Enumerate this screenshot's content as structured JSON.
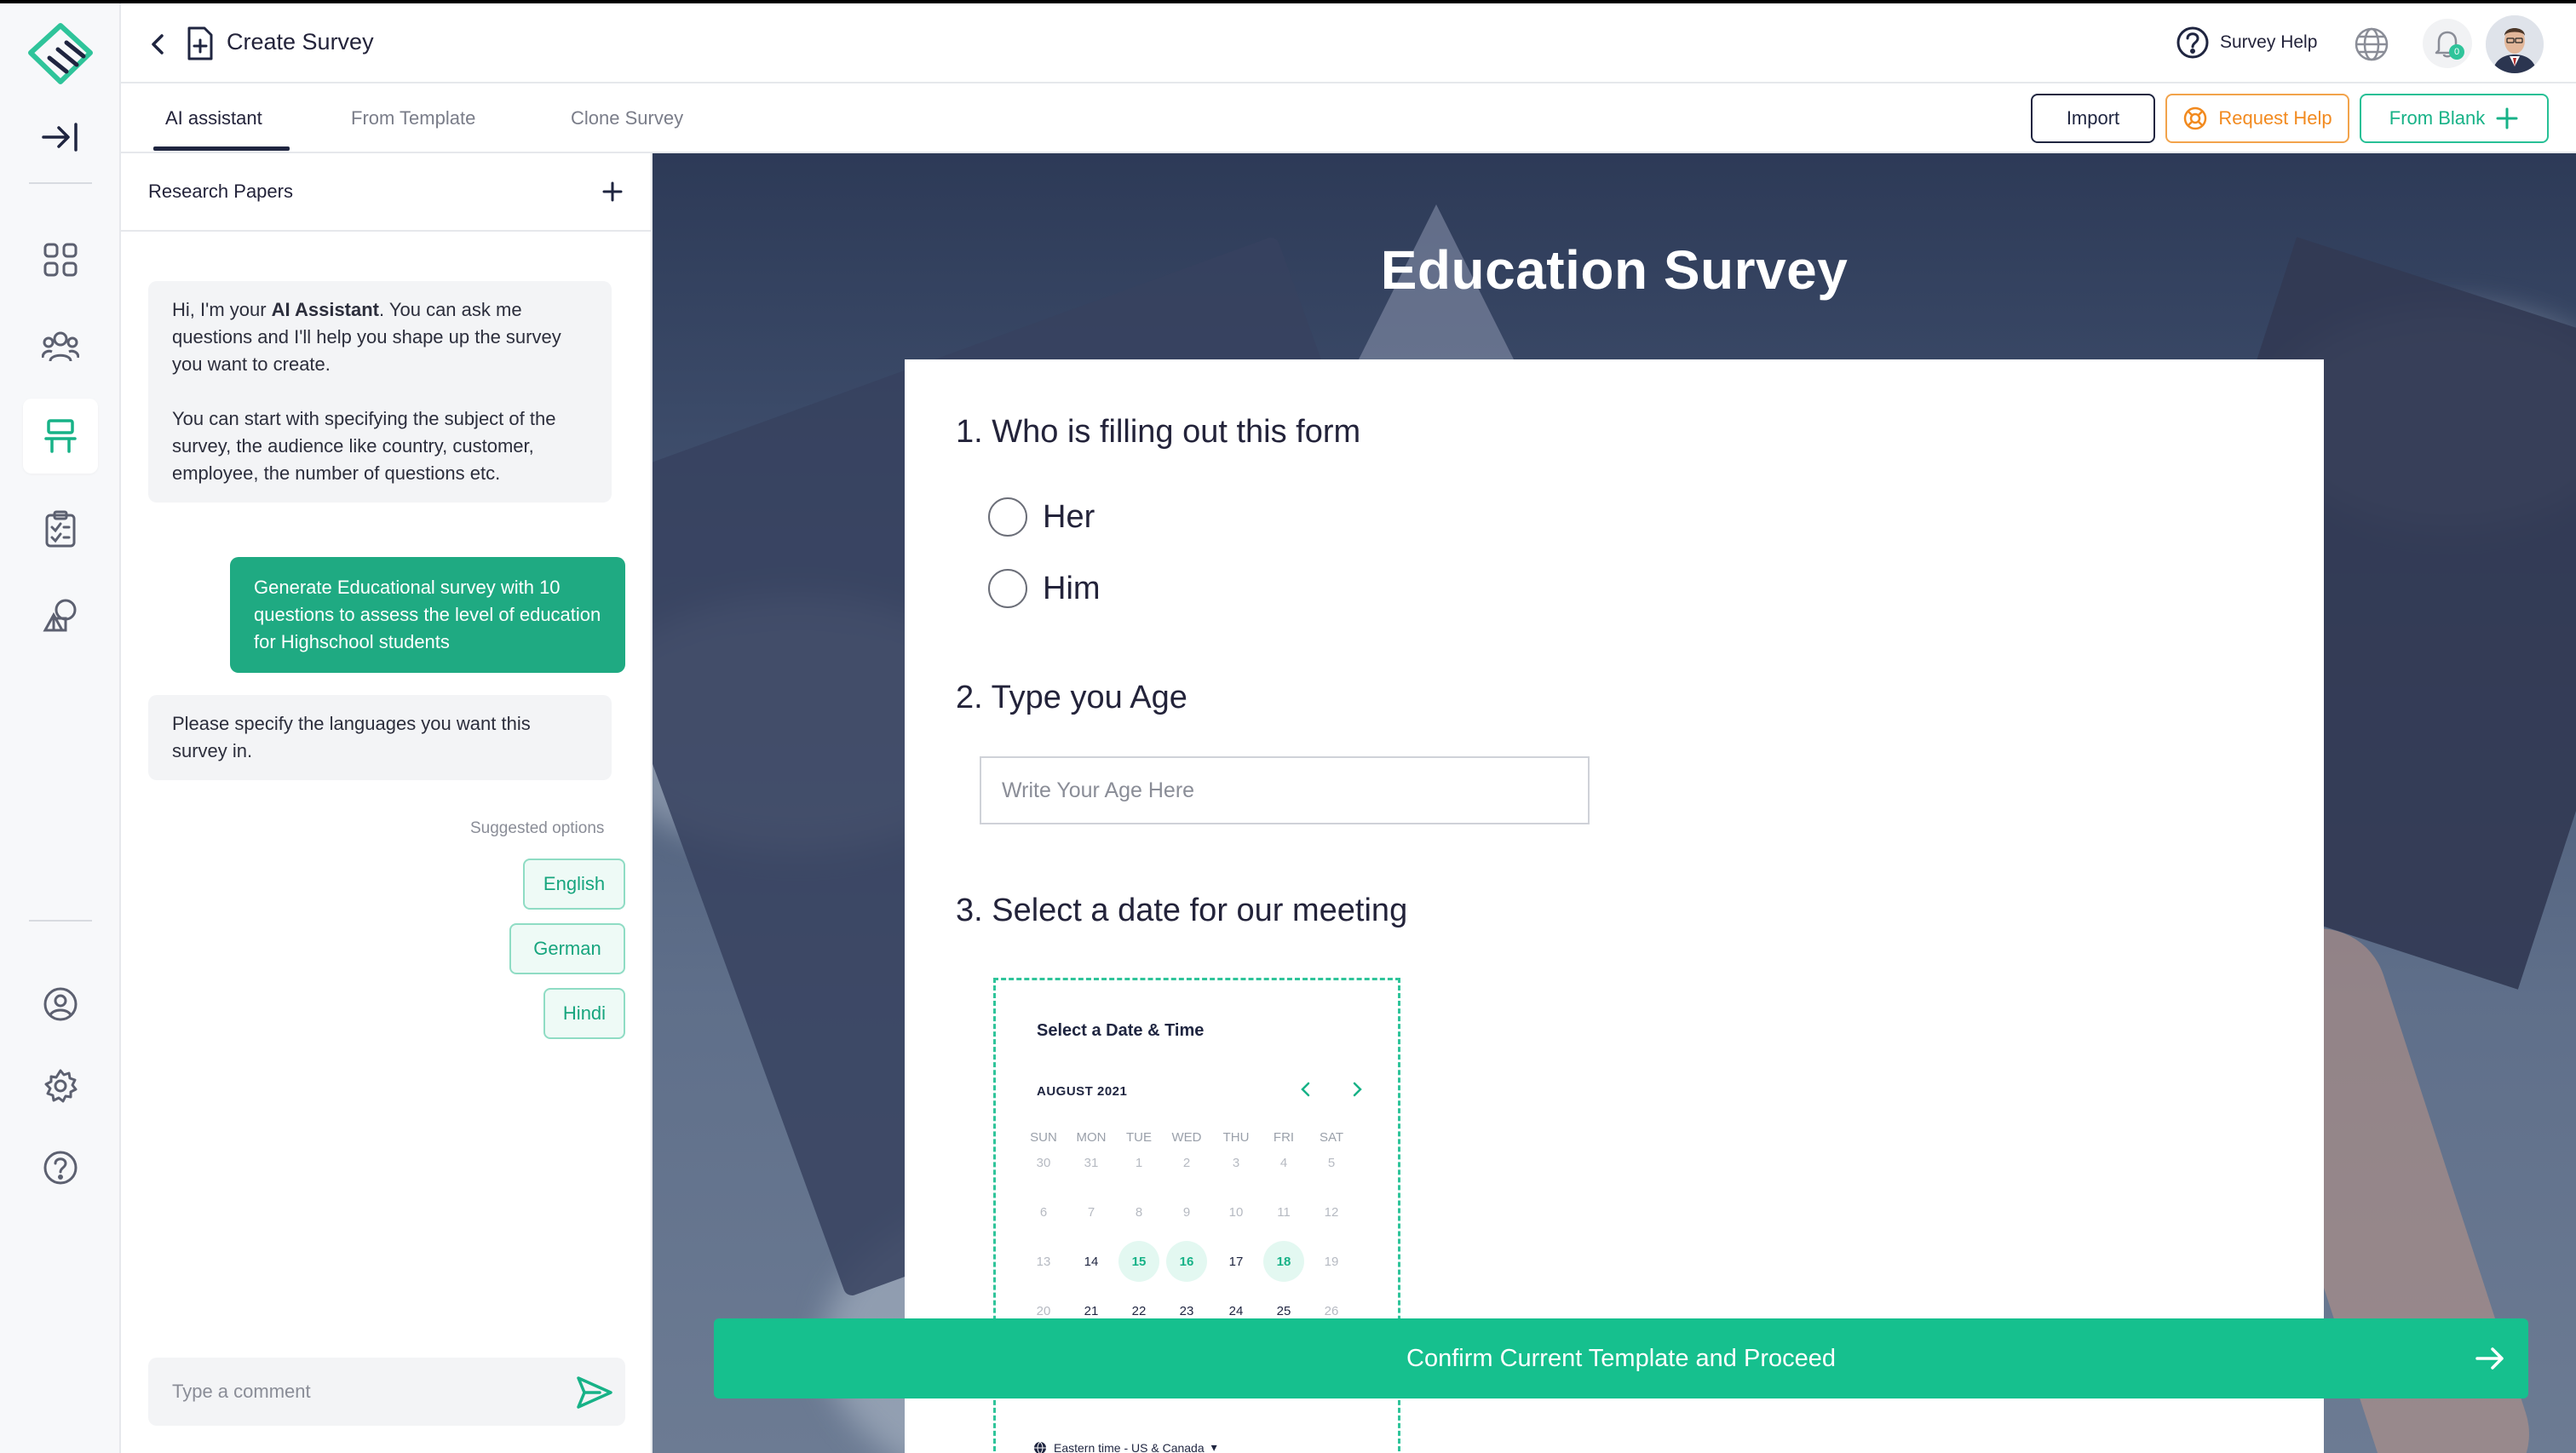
{
  "header": {
    "title": "Create Survey",
    "help_label": "Survey Help",
    "notification_count": "0"
  },
  "tabs": {
    "ai": "AI assistant",
    "template": "From Template",
    "clone": "Clone Survey"
  },
  "actions": {
    "import": "Import",
    "request_help": "Request Help",
    "from_blank": "From Blank"
  },
  "chat": {
    "section_title": "Research Papers",
    "intro_pre": "Hi, I'm your ",
    "intro_bold": "AI Assistant",
    "intro_post": ". You can ask me questions and I'll help you shape up the survey you want to create.",
    "intro_p2": "You can start  with specifying the subject of the survey, the audience like country, customer, employee, the number of questions etc.",
    "user_message": "Generate Educational survey  with 10 questions to assess the level of education for Highschool students",
    "ai_reply": "Please specify the languages you want this survey in.",
    "suggested_label": "Suggested options",
    "suggestions": [
      "English",
      "German",
      "Hindi"
    ],
    "comment_placeholder": "Type a comment"
  },
  "survey": {
    "title": "Education Survey",
    "q1": "1. Who is filling out this form",
    "q1_options": [
      "Her",
      "Him"
    ],
    "q2": "2. Type you Age",
    "q2_placeholder": "Write Your Age Here",
    "q3": "3. Select a date for our meeting",
    "calendar": {
      "title": "Select a Date & Time",
      "month": "AUGUST 2021",
      "weekdays": [
        "SUN",
        "MON",
        "TUE",
        "WED",
        "THU",
        "FRI",
        "SAT"
      ],
      "weeks": [
        [
          "30",
          "31",
          "1",
          "2",
          "3",
          "4",
          "5"
        ],
        [
          "6",
          "7",
          "8",
          "9",
          "10",
          "11",
          "12"
        ],
        [
          "13",
          "14",
          "15",
          "16",
          "17",
          "18",
          "19"
        ],
        [
          "20",
          "21",
          "22",
          "23",
          "24",
          "25",
          "26"
        ]
      ],
      "highlighted": [
        "15",
        "16",
        "18"
      ],
      "timezone": "Eastern time - US & Canada"
    },
    "confirm_label": "Confirm Current Template and Proceed"
  },
  "colors": {
    "accent": "#16c08e",
    "navy": "#1f2540",
    "orange": "#f28a1f"
  }
}
